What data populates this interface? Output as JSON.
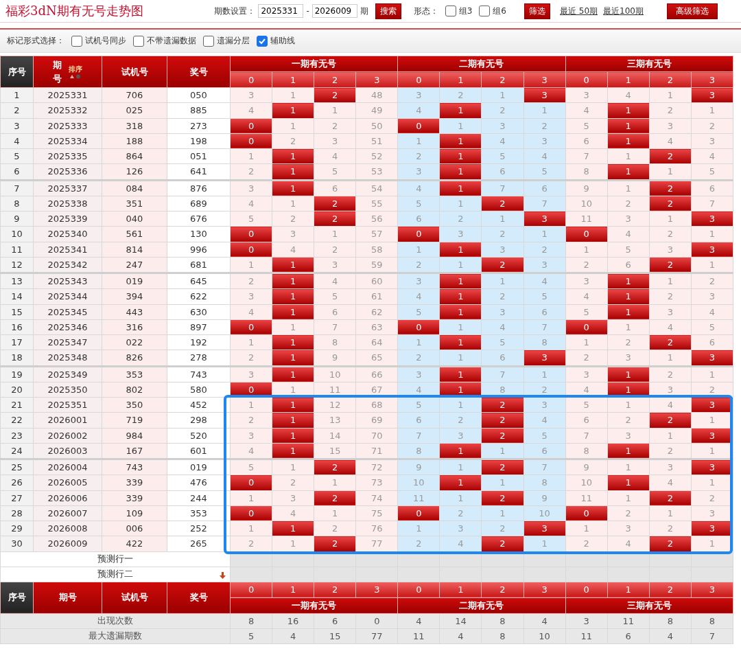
{
  "header": {
    "title": "福彩3dN期有无号走势图",
    "period_label": "期数设置：",
    "start": "2025331",
    "separator": "-",
    "end": "2026009",
    "unit": "期",
    "search_button": "搜索",
    "shape_label": "形态：",
    "shape_options": [
      {
        "label": "组3",
        "checked": false
      },
      {
        "label": "组6",
        "checked": false
      }
    ],
    "filter_button": "筛选",
    "links": [
      "最近 50期",
      "最近100期"
    ],
    "advanced_button": "高级筛选"
  },
  "mark_options": {
    "label": "标记形式选择：",
    "options": [
      {
        "label": "试机号同步",
        "checked": false
      },
      {
        "label": "不带遗漏数据",
        "checked": false
      },
      {
        "label": "遗漏分层",
        "checked": false
      },
      {
        "label": "辅助线",
        "checked": true
      }
    ]
  },
  "table": {
    "columns": [
      "序号",
      "期号",
      "试机号",
      "奖号"
    ],
    "sort_label": "排序",
    "groups": [
      {
        "title": "一期有无号",
        "digits": [
          "0",
          "1",
          "2",
          "3"
        ]
      },
      {
        "title": "二期有无号",
        "digits": [
          "0",
          "1",
          "2",
          "3"
        ]
      },
      {
        "title": "三期有无号",
        "digits": [
          "0",
          "1",
          "2",
          "3"
        ]
      }
    ],
    "rows": [
      {
        "seq": "1",
        "period": "2025331",
        "trial": "706",
        "award": "050",
        "boxed": false,
        "cells": [
          "3",
          "1",
          "2",
          "48",
          "3",
          "2",
          "1",
          "3",
          "3",
          "4",
          "1",
          "3"
        ],
        "hit": [
          false,
          false,
          true,
          false,
          false,
          false,
          false,
          true,
          false,
          false,
          false,
          true
        ]
      },
      {
        "seq": "2",
        "period": "2025332",
        "trial": "025",
        "award": "885",
        "boxed": false,
        "cells": [
          "4",
          "1",
          "1",
          "49",
          "4",
          "1",
          "2",
          "1",
          "4",
          "1",
          "2",
          "1"
        ],
        "hit": [
          false,
          true,
          false,
          false,
          false,
          true,
          false,
          false,
          false,
          true,
          false,
          false
        ]
      },
      {
        "seq": "3",
        "period": "2025333",
        "trial": "318",
        "award": "273",
        "boxed": false,
        "cells": [
          "0",
          "1",
          "2",
          "50",
          "0",
          "1",
          "3",
          "2",
          "5",
          "1",
          "3",
          "2"
        ],
        "hit": [
          true,
          false,
          false,
          false,
          true,
          false,
          false,
          false,
          false,
          true,
          false,
          false
        ]
      },
      {
        "seq": "4",
        "period": "2025334",
        "trial": "188",
        "award": "198",
        "boxed": false,
        "cells": [
          "0",
          "2",
          "3",
          "51",
          "1",
          "1",
          "4",
          "3",
          "6",
          "1",
          "4",
          "3"
        ],
        "hit": [
          true,
          false,
          false,
          false,
          false,
          true,
          false,
          false,
          false,
          true,
          false,
          false
        ]
      },
      {
        "seq": "5",
        "period": "2025335",
        "trial": "864",
        "award": "051",
        "boxed": false,
        "cells": [
          "1",
          "1",
          "4",
          "52",
          "2",
          "1",
          "5",
          "4",
          "7",
          "1",
          "2",
          "4"
        ],
        "hit": [
          false,
          true,
          false,
          false,
          false,
          true,
          false,
          false,
          false,
          false,
          true,
          false
        ]
      },
      {
        "seq": "6",
        "period": "2025336",
        "trial": "126",
        "award": "641",
        "boxed": false,
        "cells": [
          "2",
          "1",
          "5",
          "53",
          "3",
          "1",
          "6",
          "5",
          "8",
          "1",
          "1",
          "5"
        ],
        "hit": [
          false,
          true,
          false,
          false,
          false,
          true,
          false,
          false,
          false,
          true,
          false,
          false
        ]
      },
      {
        "seq": "7",
        "period": "2025337",
        "trial": "084",
        "award": "876",
        "boxed": false,
        "cells": [
          "3",
          "1",
          "6",
          "54",
          "4",
          "1",
          "7",
          "6",
          "9",
          "1",
          "2",
          "6"
        ],
        "hit": [
          false,
          true,
          false,
          false,
          false,
          true,
          false,
          false,
          false,
          false,
          true,
          false
        ]
      },
      {
        "seq": "8",
        "period": "2025338",
        "trial": "351",
        "award": "689",
        "boxed": false,
        "cells": [
          "4",
          "1",
          "2",
          "55",
          "5",
          "1",
          "2",
          "7",
          "10",
          "2",
          "2",
          "7"
        ],
        "hit": [
          false,
          false,
          true,
          false,
          false,
          false,
          true,
          false,
          false,
          false,
          true,
          false
        ]
      },
      {
        "seq": "9",
        "period": "2025339",
        "trial": "040",
        "award": "676",
        "boxed": false,
        "cells": [
          "5",
          "2",
          "2",
          "56",
          "6",
          "2",
          "1",
          "3",
          "11",
          "3",
          "1",
          "3"
        ],
        "hit": [
          false,
          false,
          true,
          false,
          false,
          false,
          false,
          true,
          false,
          false,
          false,
          true
        ]
      },
      {
        "seq": "10",
        "period": "2025340",
        "trial": "561",
        "award": "130",
        "boxed": false,
        "cells": [
          "0",
          "3",
          "1",
          "57",
          "0",
          "3",
          "2",
          "1",
          "0",
          "4",
          "2",
          "1"
        ],
        "hit": [
          true,
          false,
          false,
          false,
          true,
          false,
          false,
          false,
          true,
          false,
          false,
          false
        ]
      },
      {
        "seq": "11",
        "period": "2025341",
        "trial": "814",
        "award": "996",
        "boxed": false,
        "cells": [
          "0",
          "4",
          "2",
          "58",
          "1",
          "1",
          "3",
          "2",
          "1",
          "5",
          "3",
          "3"
        ],
        "hit": [
          true,
          false,
          false,
          false,
          false,
          true,
          false,
          false,
          false,
          false,
          false,
          true
        ]
      },
      {
        "seq": "12",
        "period": "2025342",
        "trial": "247",
        "award": "681",
        "boxed": false,
        "cells": [
          "1",
          "1",
          "3",
          "59",
          "2",
          "1",
          "2",
          "3",
          "2",
          "6",
          "2",
          "1"
        ],
        "hit": [
          false,
          true,
          false,
          false,
          false,
          false,
          true,
          false,
          false,
          false,
          true,
          false
        ]
      },
      {
        "seq": "13",
        "period": "2025343",
        "trial": "019",
        "award": "645",
        "boxed": false,
        "cells": [
          "2",
          "1",
          "4",
          "60",
          "3",
          "1",
          "1",
          "4",
          "3",
          "1",
          "1",
          "2"
        ],
        "hit": [
          false,
          true,
          false,
          false,
          false,
          true,
          false,
          false,
          false,
          true,
          false,
          false
        ]
      },
      {
        "seq": "14",
        "period": "2025344",
        "trial": "394",
        "award": "622",
        "boxed": false,
        "cells": [
          "3",
          "1",
          "5",
          "61",
          "4",
          "1",
          "2",
          "5",
          "4",
          "1",
          "2",
          "3"
        ],
        "hit": [
          false,
          true,
          false,
          false,
          false,
          true,
          false,
          false,
          false,
          true,
          false,
          false
        ]
      },
      {
        "seq": "15",
        "period": "2025345",
        "trial": "443",
        "award": "630",
        "boxed": false,
        "cells": [
          "4",
          "1",
          "6",
          "62",
          "5",
          "1",
          "3",
          "6",
          "5",
          "1",
          "3",
          "4"
        ],
        "hit": [
          false,
          true,
          false,
          false,
          false,
          true,
          false,
          false,
          false,
          true,
          false,
          false
        ]
      },
      {
        "seq": "16",
        "period": "2025346",
        "trial": "316",
        "award": "897",
        "boxed": false,
        "cells": [
          "0",
          "1",
          "7",
          "63",
          "0",
          "1",
          "4",
          "7",
          "0",
          "1",
          "4",
          "5"
        ],
        "hit": [
          true,
          false,
          false,
          false,
          true,
          false,
          false,
          false,
          true,
          false,
          false,
          false
        ]
      },
      {
        "seq": "17",
        "period": "2025347",
        "trial": "022",
        "award": "192",
        "boxed": false,
        "cells": [
          "1",
          "1",
          "8",
          "64",
          "1",
          "1",
          "5",
          "8",
          "1",
          "2",
          "2",
          "6"
        ],
        "hit": [
          false,
          true,
          false,
          false,
          false,
          true,
          false,
          false,
          false,
          false,
          true,
          false
        ]
      },
      {
        "seq": "18",
        "period": "2025348",
        "trial": "826",
        "award": "278",
        "boxed": false,
        "cells": [
          "2",
          "1",
          "9",
          "65",
          "2",
          "1",
          "6",
          "3",
          "2",
          "3",
          "1",
          "3"
        ],
        "hit": [
          false,
          true,
          false,
          false,
          false,
          false,
          false,
          true,
          false,
          false,
          false,
          true
        ]
      },
      {
        "seq": "19",
        "period": "2025349",
        "trial": "353",
        "award": "743",
        "boxed": false,
        "cells": [
          "3",
          "1",
          "10",
          "66",
          "3",
          "1",
          "7",
          "1",
          "3",
          "1",
          "2",
          "1"
        ],
        "hit": [
          false,
          true,
          false,
          false,
          false,
          true,
          false,
          false,
          false,
          true,
          false,
          false
        ]
      },
      {
        "seq": "20",
        "period": "2025350",
        "trial": "802",
        "award": "580",
        "boxed": false,
        "cells": [
          "0",
          "1",
          "11",
          "67",
          "4",
          "1",
          "8",
          "2",
          "4",
          "1",
          "3",
          "2"
        ],
        "hit": [
          true,
          false,
          false,
          false,
          false,
          true,
          false,
          false,
          false,
          true,
          false,
          false
        ]
      },
      {
        "seq": "21",
        "period": "2025351",
        "trial": "350",
        "award": "452",
        "boxed": true,
        "cells": [
          "1",
          "1",
          "12",
          "68",
          "5",
          "1",
          "2",
          "3",
          "5",
          "1",
          "4",
          "3"
        ],
        "hit": [
          false,
          true,
          false,
          false,
          false,
          false,
          true,
          false,
          false,
          false,
          false,
          true
        ]
      },
      {
        "seq": "22",
        "period": "2026001",
        "trial": "719",
        "award": "298",
        "boxed": true,
        "cells": [
          "2",
          "1",
          "13",
          "69",
          "6",
          "2",
          "2",
          "4",
          "6",
          "2",
          "2",
          "1"
        ],
        "hit": [
          false,
          true,
          false,
          false,
          false,
          false,
          true,
          false,
          false,
          false,
          true,
          false
        ]
      },
      {
        "seq": "23",
        "period": "2026002",
        "trial": "984",
        "award": "520",
        "boxed": true,
        "cells": [
          "3",
          "1",
          "14",
          "70",
          "7",
          "3",
          "2",
          "5",
          "7",
          "3",
          "1",
          "3"
        ],
        "hit": [
          false,
          true,
          false,
          false,
          false,
          false,
          true,
          false,
          false,
          false,
          false,
          true
        ]
      },
      {
        "seq": "24",
        "period": "2026003",
        "trial": "167",
        "award": "601",
        "boxed": true,
        "cells": [
          "4",
          "1",
          "15",
          "71",
          "8",
          "1",
          "1",
          "6",
          "8",
          "1",
          "2",
          "1"
        ],
        "hit": [
          false,
          true,
          false,
          false,
          false,
          true,
          false,
          false,
          false,
          true,
          false,
          false
        ]
      },
      {
        "seq": "25",
        "period": "2026004",
        "trial": "743",
        "award": "019",
        "boxed": true,
        "cells": [
          "5",
          "1",
          "2",
          "72",
          "9",
          "1",
          "2",
          "7",
          "9",
          "1",
          "3",
          "3"
        ],
        "hit": [
          false,
          false,
          true,
          false,
          false,
          false,
          true,
          false,
          false,
          false,
          false,
          true
        ]
      },
      {
        "seq": "26",
        "period": "2026005",
        "trial": "339",
        "award": "476",
        "boxed": true,
        "cells": [
          "0",
          "2",
          "1",
          "73",
          "10",
          "1",
          "1",
          "8",
          "10",
          "1",
          "4",
          "1"
        ],
        "hit": [
          true,
          false,
          false,
          false,
          false,
          true,
          false,
          false,
          false,
          true,
          false,
          false
        ]
      },
      {
        "seq": "27",
        "period": "2026006",
        "trial": "339",
        "award": "244",
        "boxed": true,
        "cells": [
          "1",
          "3",
          "2",
          "74",
          "11",
          "1",
          "2",
          "9",
          "11",
          "1",
          "2",
          "2"
        ],
        "hit": [
          false,
          false,
          true,
          false,
          false,
          false,
          true,
          false,
          false,
          false,
          true,
          false
        ]
      },
      {
        "seq": "28",
        "period": "2026007",
        "trial": "109",
        "award": "353",
        "boxed": true,
        "cells": [
          "0",
          "4",
          "1",
          "75",
          "0",
          "2",
          "1",
          "10",
          "0",
          "2",
          "1",
          "3"
        ],
        "hit": [
          true,
          false,
          false,
          false,
          true,
          false,
          false,
          false,
          true,
          false,
          false,
          false
        ]
      },
      {
        "seq": "29",
        "period": "2026008",
        "trial": "006",
        "award": "252",
        "boxed": true,
        "cells": [
          "1",
          "1",
          "2",
          "76",
          "1",
          "3",
          "2",
          "3",
          "1",
          "3",
          "2",
          "3"
        ],
        "hit": [
          false,
          true,
          false,
          false,
          false,
          false,
          false,
          true,
          false,
          false,
          false,
          true
        ]
      },
      {
        "seq": "30",
        "period": "2026009",
        "trial": "422",
        "award": "265",
        "boxed": true,
        "cells": [
          "2",
          "1",
          "2",
          "77",
          "2",
          "4",
          "2",
          "1",
          "2",
          "4",
          "2",
          "1"
        ],
        "hit": [
          false,
          false,
          true,
          false,
          false,
          false,
          true,
          false,
          false,
          false,
          true,
          false
        ]
      }
    ],
    "prediction_rows": [
      "预测行一",
      "预测行二"
    ],
    "footer_columns": [
      "序号",
      "期号",
      "试机号",
      "奖号"
    ],
    "footer_groups": [
      {
        "title": "一期有无号",
        "digits": [
          "0",
          "1",
          "2",
          "3"
        ]
      },
      {
        "title": "二期有无号",
        "digits": [
          "0",
          "1",
          "2",
          "3"
        ]
      },
      {
        "title": "三期有无号",
        "digits": [
          "0",
          "1",
          "2",
          "3"
        ]
      }
    ],
    "stats": [
      {
        "label": "出现次数",
        "values": [
          "8",
          "16",
          "6",
          "0",
          "4",
          "14",
          "8",
          "4",
          "3",
          "11",
          "8",
          "8"
        ]
      },
      {
        "label": "最大遗漏期数",
        "values": [
          "5",
          "4",
          "15",
          "77",
          "11",
          "4",
          "8",
          "10",
          "11",
          "6",
          "4",
          "7"
        ]
      }
    ]
  }
}
